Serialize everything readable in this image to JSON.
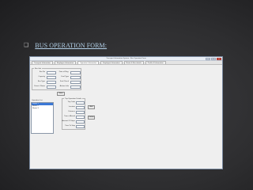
{
  "slide": {
    "bullet": "❑",
    "title": "BUS OPERATION FORM:"
  },
  "window": {
    "title": "Transport Information System - Bus Operation Form",
    "controls": {
      "minimize": "–",
      "maximize": "□",
      "close": "x"
    },
    "tabs": [
      "Transport Information",
      "Employee Information",
      "Operation Information",
      "Employee Information",
      "Route & Bus details",
      "Profile & Information"
    ],
    "bus_info": {
      "legend": "Bus Info",
      "labels": [
        "Bus No",
        "Capacity",
        "Bus Type",
        "Driver's Name",
        "Date of Reg.",
        "Fuel Type",
        "Fuel Check",
        "Actions Info"
      ]
    },
    "save_label": "Save",
    "list": {
      "legend": "Operation List",
      "items": [
        "Route 1",
        "Route 2",
        "Route 3"
      ]
    },
    "trip_info": {
      "legend": "Trip Operation Details",
      "labels": [
        "Trip Code",
        "Location",
        "Distance",
        "Time of Arrival",
        "Amount Of Stops",
        "Time To Stop"
      ],
      "add_label": "Add",
      "delete_label": "Delete"
    }
  }
}
